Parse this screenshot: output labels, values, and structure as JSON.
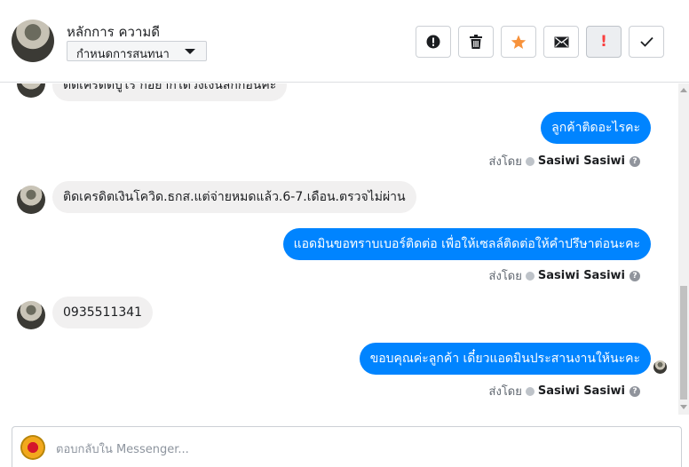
{
  "header": {
    "contact_name": "หลักการ ความดี",
    "label_select": "กำหนดการสนทนา",
    "toolbar": {
      "spam": "exclamation-circle-icon",
      "delete": "trash-icon",
      "star": "star-icon",
      "mark_unread": "envelope-icon",
      "follow_up": "!",
      "done": "check-icon"
    }
  },
  "thread": {
    "messages": [
      {
        "direction": "in",
        "text": "ติดเครดิตเงินโควิด.ธกส.แต่จ่ายหมดแล้ว.6-7.เดือน.ตรวจไม่ผ่าน"
      },
      {
        "direction": "out",
        "text": "ลูกค้าติดอะไรคะ"
      },
      {
        "direction": "out",
        "text": "แอดมินขอทราบเบอร์ติดต่อ เพื่อให้เซลล์ติดต่อให้คำปรึษาต่อนะคะ"
      },
      {
        "direction": "in",
        "text": "0935511341"
      },
      {
        "direction": "out",
        "text": "ขอบคุณค่ะลูกค้า เดี๋ยวแอดมินประสานงานให้นะคะ"
      }
    ],
    "partial_top_text": "ติดเครดิตบูโร ก็อยากได้วงเงินสักก้อนค่ะ",
    "sent_by_label": "ส่งโดย",
    "agent_name": "Sasiwi Sasiwi",
    "help_glyph": "?"
  },
  "composer": {
    "placeholder": "ตอบกลับใน Messenger..."
  },
  "colors": {
    "outgoing_bubble": "#0084ff",
    "incoming_bubble": "#f1f0f0",
    "star": "#f7923b",
    "follow_up": "#fa3e3e"
  }
}
